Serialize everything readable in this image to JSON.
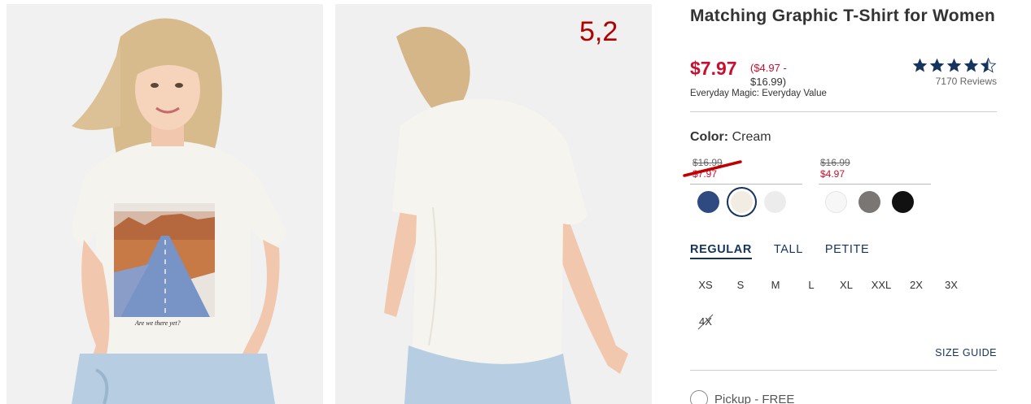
{
  "annotation": "5,2",
  "product": {
    "title": "Matching Graphic T-Shirt for Women",
    "sale_price": "$7.97",
    "range_low": "($4.97 -",
    "range_high": "$16.99)",
    "tagline": "Everyday Magic: Everyday Value",
    "rating_stars": 4.5,
    "review_count": "7170 Reviews"
  },
  "photos": {
    "front_graphic_caption": "Are we there yet?"
  },
  "color": {
    "label": "Color:",
    "value": "Cream",
    "groups": [
      {
        "old_price": "$16.99",
        "new_price": "$7.97"
      },
      {
        "old_price": "$16.99",
        "new_price": "$4.97"
      }
    ],
    "swatches": [
      {
        "name": "navy",
        "hex": "#2f4a80"
      },
      {
        "name": "cream",
        "hex": "#f1ede3",
        "selected": true
      },
      {
        "name": "light-gray",
        "hex": "#ececec"
      },
      {
        "name": "white",
        "hex": "#f7f7f7"
      },
      {
        "name": "heather-gray",
        "hex": "#7a7674"
      },
      {
        "name": "black",
        "hex": "#111111"
      }
    ],
    "accent": "#15345e",
    "sale_red": "#c8102e"
  },
  "fit_tabs": [
    "REGULAR",
    "TALL",
    "PETITE"
  ],
  "active_fit": "REGULAR",
  "sizes": [
    "XS",
    "S",
    "M",
    "L",
    "XL",
    "XXL",
    "2X",
    "3X"
  ],
  "unavailable_size": "4X",
  "size_guide": "SIZE GUIDE",
  "pickup_label": "Pickup - FREE"
}
